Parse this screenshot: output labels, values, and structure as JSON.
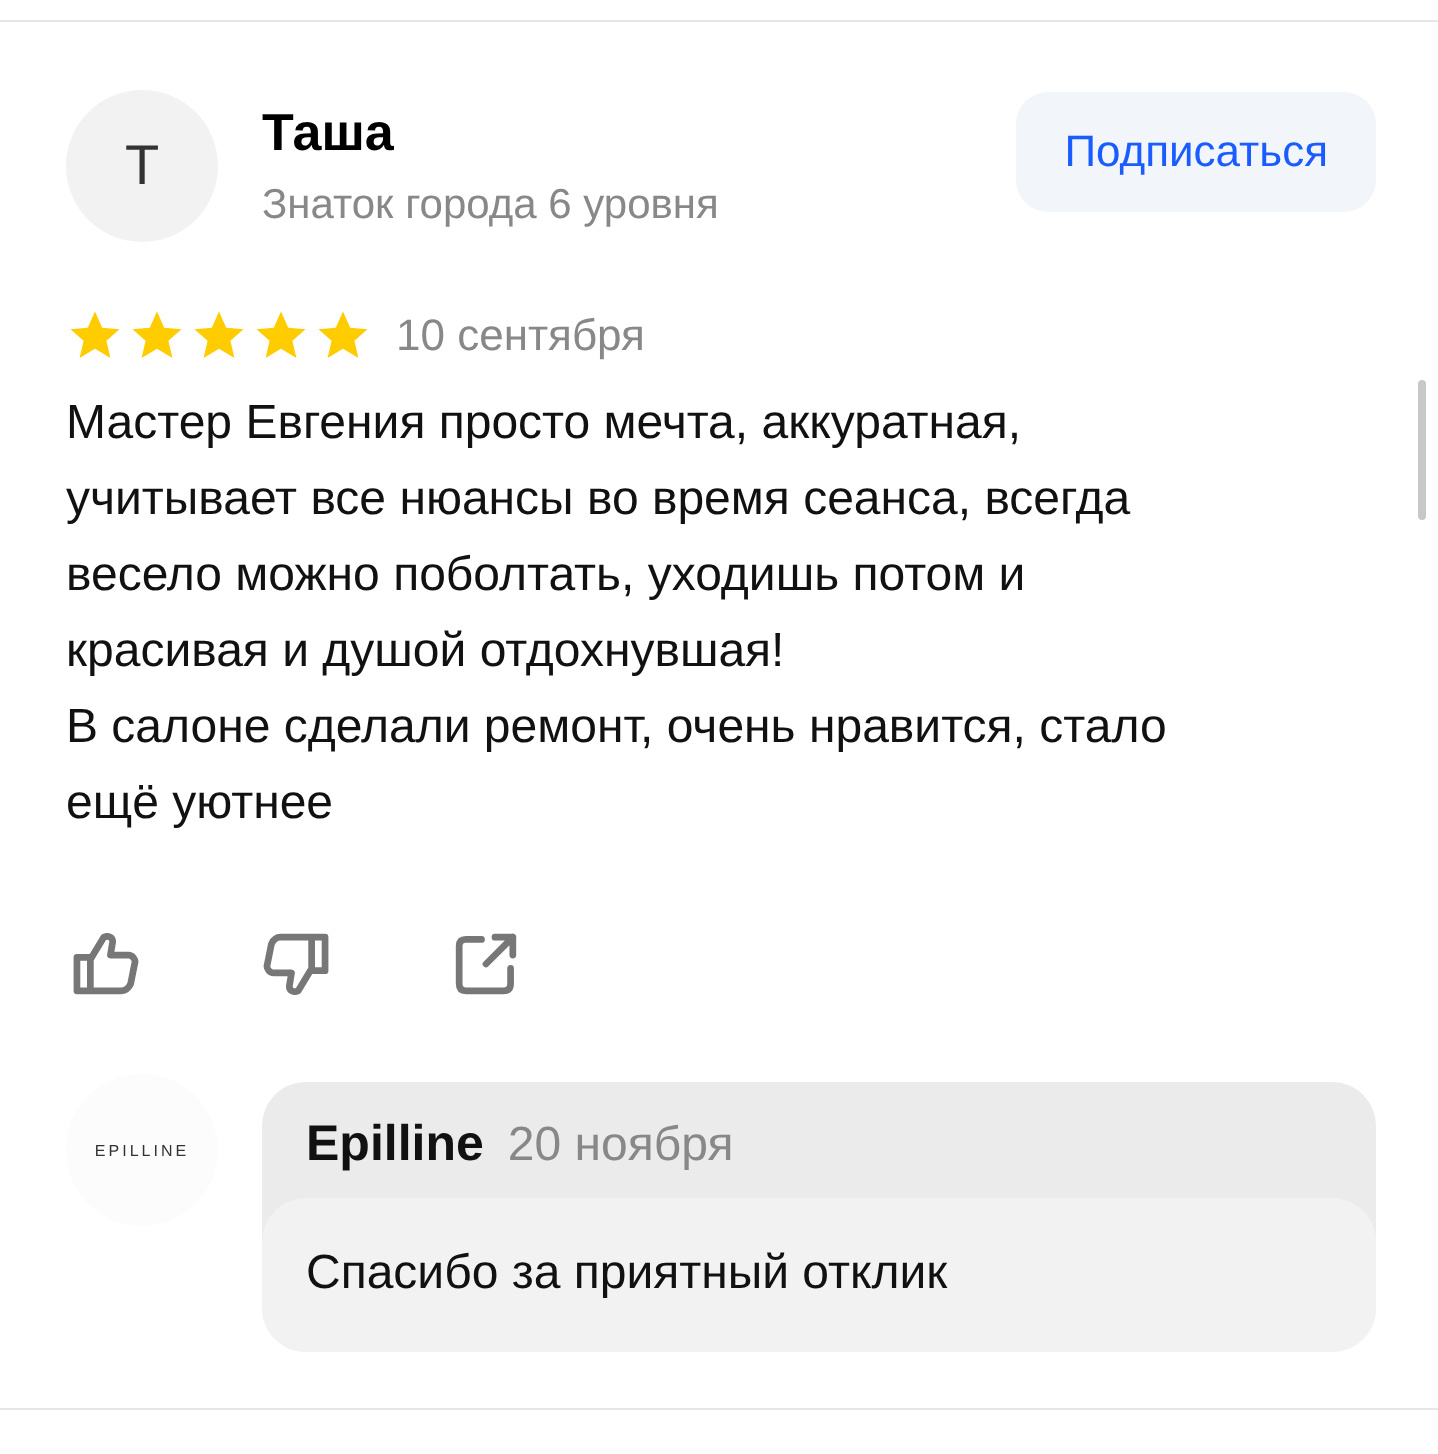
{
  "review": {
    "author": {
      "initial": "Т",
      "name": "Таша",
      "status": "Знаток города 6 уровня"
    },
    "subscribe_button": "Подписаться",
    "stars": 5,
    "date": "10 сентября",
    "text": [
      "Мастер Евгения просто мечта, аккуратная, учитывает все нюансы во время сеанса, всегда весело можно поболтать, уходишь потом и красивая и душой отдохнувшая!",
      "В салоне сделали ремонт, очень нравится, стало ещё уютнее"
    ],
    "actions": [
      {
        "kind": "like"
      },
      {
        "kind": "dislike"
      },
      {
        "kind": "share"
      }
    ]
  },
  "reply": {
    "logo": "EPILLINE",
    "author": "Epilline",
    "date": "20 ноября",
    "text": "Спасибо за приятный отклик"
  }
}
